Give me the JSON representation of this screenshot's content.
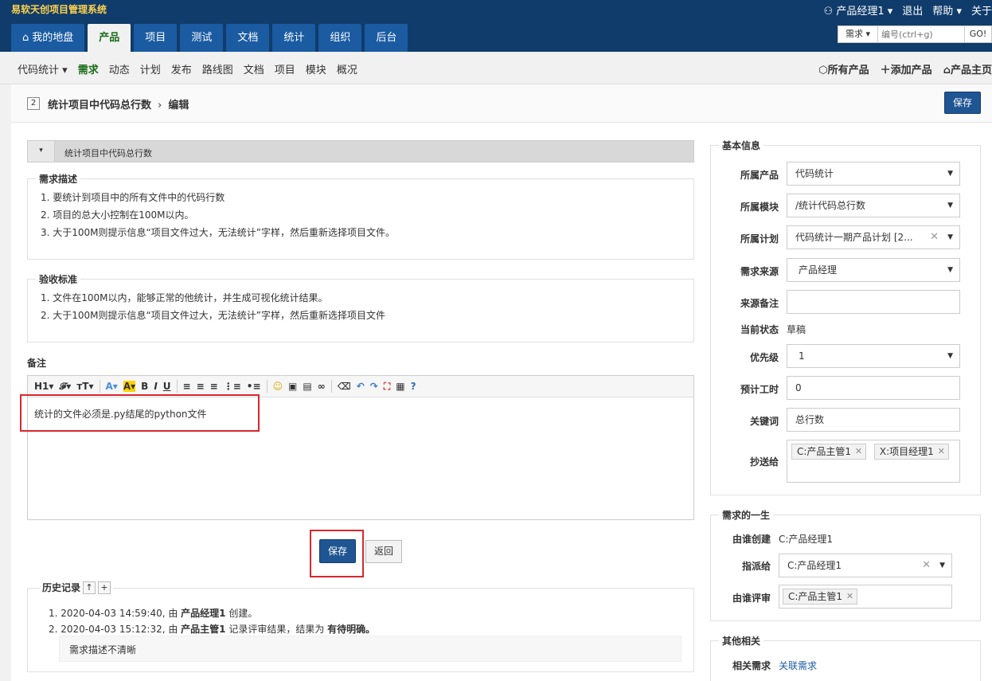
{
  "app": {
    "title": "易软天创项目管理系统"
  },
  "user": {
    "name": "产品经理1",
    "logout": "退出",
    "help": "帮助",
    "about": "关于"
  },
  "mainnav": [
    "我的地盘",
    "产品",
    "项目",
    "测试",
    "文档",
    "统计",
    "组织",
    "后台"
  ],
  "search": {
    "type": "需求",
    "placeholder": "编号(ctrl+g)",
    "go": "GO!"
  },
  "subnav": {
    "product": "代码统计",
    "items": [
      "需求",
      "动态",
      "计划",
      "发布",
      "路线图",
      "文档",
      "项目",
      "模块",
      "概况"
    ],
    "right": [
      "所有产品",
      "添加产品",
      "产品主页"
    ]
  },
  "titlebar": {
    "id": "2",
    "title": "统计项目中代码总行数",
    "action": "编辑",
    "save": "保存"
  },
  "req_title": "统计项目中代码总行数",
  "desc": {
    "legend": "需求描述",
    "lines": [
      "1. 要统计到项目中的所有文件中的代码行数",
      "2. 项目的总大小控制在100M以内。",
      "3. 大于100M则提示信息“项目文件过大，无法统计”字样，然后重新选择项目文件。"
    ]
  },
  "accept": {
    "legend": "验收标准",
    "lines": [
      "1. 文件在100M以内，能够正常的他统计，并生成可视化统计结果。",
      "2. 大于100M则提示信息“项目文件过大，无法统计”字样，然后重新选择项目文件"
    ]
  },
  "notes": {
    "label": "备注",
    "content": "统计的文件必须是.py结尾的python文件",
    "toolbar": [
      "H1",
      "𝓕",
      "тT",
      "A",
      "A",
      "B",
      "I",
      "U"
    ]
  },
  "buttons": {
    "save": "保存",
    "back": "返回"
  },
  "history": {
    "label": "历史记录",
    "up": "↑",
    "plus": "+",
    "entries": [
      {
        "pre": "1. 2020-04-03 14:59:40, 由 ",
        "who": "产品经理1",
        "post": " 创建。",
        "extra": ""
      },
      {
        "pre": "2. 2020-04-03 15:12:32, 由 ",
        "who": "产品主管1",
        "post": " 记录评审结果，结果为 ",
        "extra": "有待明确。"
      }
    ],
    "note": "需求描述不清晰"
  },
  "basic": {
    "legend": "基本信息",
    "product": {
      "label": "所属产品",
      "value": "代码统计"
    },
    "module": {
      "label": "所属模块",
      "value": "/统计代码总行数"
    },
    "plan": {
      "label": "所属计划",
      "value": "代码统计一期产品计划 [2..."
    },
    "source": {
      "label": "需求来源",
      "value": "产品经理"
    },
    "source_note": {
      "label": "来源备注",
      "value": ""
    },
    "status": {
      "label": "当前状态",
      "value": "草稿"
    },
    "priority": {
      "label": "优先级",
      "value": "1"
    },
    "estimate": {
      "label": "预计工时",
      "value": "0"
    },
    "keywords": {
      "label": "关键词",
      "value": "总行数"
    },
    "cc": {
      "label": "抄送给",
      "tags": [
        "C:产品主管1",
        "X:项目经理1"
      ]
    }
  },
  "life": {
    "legend": "需求的一生",
    "created_by": {
      "label": "由谁创建",
      "value": "C:产品经理1"
    },
    "assigned": {
      "label": "指派给",
      "value": "C:产品经理1"
    },
    "reviewer": {
      "label": "由谁评审",
      "tag": "C:产品主管1"
    }
  },
  "other": {
    "legend": "其他相关",
    "related": {
      "label": "相关需求",
      "link": "关联需求"
    }
  }
}
